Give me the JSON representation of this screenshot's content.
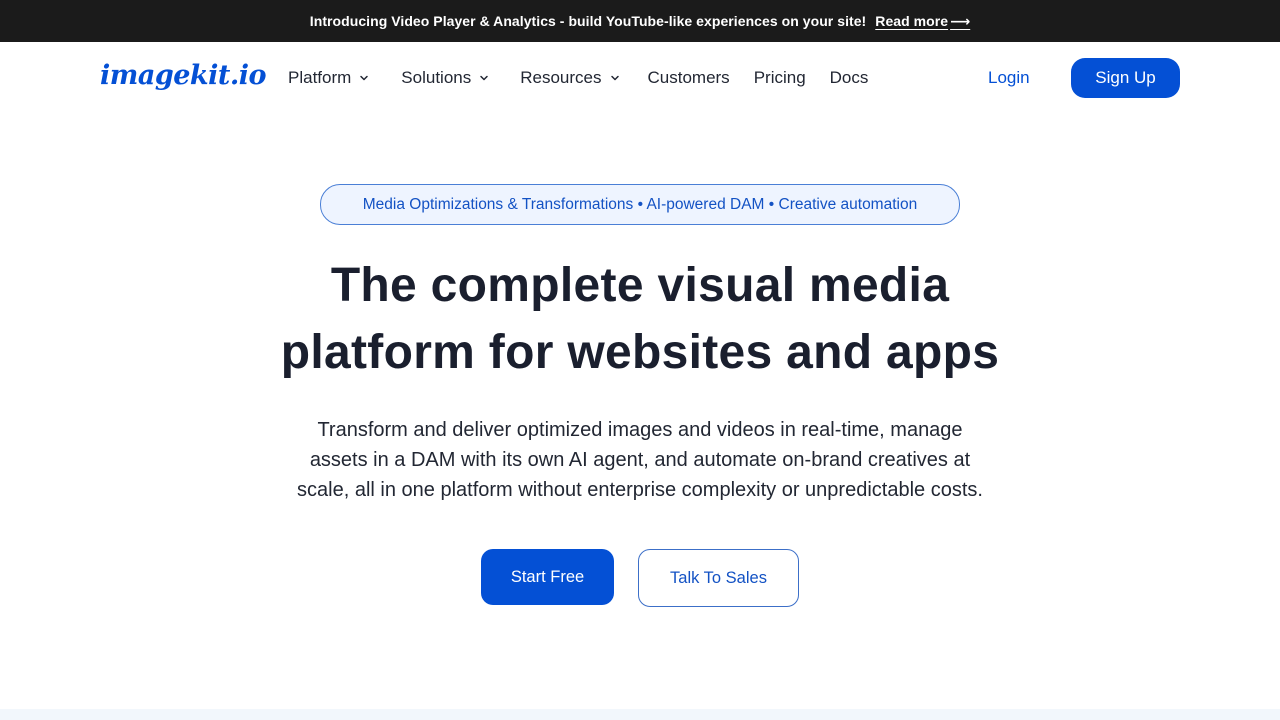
{
  "announcement": {
    "message": "Introducing Video Player & Analytics - build YouTube-like experiences on your site!",
    "link_label": "Read more",
    "link_arrow": "⟶"
  },
  "header": {
    "logo_text": "imagekit.io",
    "nav": [
      {
        "label": "Platform",
        "has_dropdown": true
      },
      {
        "label": "Solutions",
        "has_dropdown": true
      },
      {
        "label": "Resources",
        "has_dropdown": true
      },
      {
        "label": "Customers",
        "has_dropdown": false
      },
      {
        "label": "Pricing",
        "has_dropdown": false
      },
      {
        "label": "Docs",
        "has_dropdown": false
      }
    ],
    "login_label": "Login",
    "signup_label": "Sign Up"
  },
  "hero": {
    "pill_text": "Media Optimizations & Transformations • AI-powered DAM • Creative automation",
    "headline_line1": "The complete visual media",
    "headline_line2": "platform for websites and apps",
    "subtext_line1": "Transform and deliver optimized images and videos in real-time, manage",
    "subtext_line2": "assets in a DAM with its own AI agent, and automate on-brand creatives at",
    "subtext_line3": "scale, all in one platform without enterprise complexity or unpredictable costs.",
    "primary_cta": "Start Free",
    "secondary_cta": "Talk To Sales"
  },
  "colors": {
    "brand_blue": "#0450d5",
    "announcement_bg": "#1b1b1b",
    "text_dark": "#1a1f2e",
    "pill_bg": "#eef4ff"
  }
}
